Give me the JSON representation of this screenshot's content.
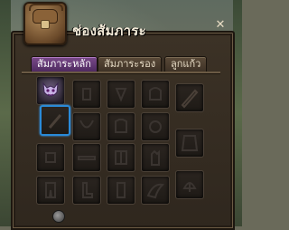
{
  "window": {
    "title": "ช่องสัมภาระ",
    "close_glyph": "✕"
  },
  "tabs": [
    {
      "label": "สัมภาระหลัก",
      "active": true
    },
    {
      "label": "สัมภาระรอง",
      "active": false
    },
    {
      "label": "ลูกแก้ว",
      "active": false
    }
  ],
  "slots": [
    {
      "id": "helmet",
      "icon": "demon-mask-icon",
      "equipped": true
    },
    {
      "id": "slot-2",
      "icon": "slot-2-icon"
    },
    {
      "id": "slot-3",
      "icon": "slot-3-icon"
    },
    {
      "id": "slot-4",
      "icon": "slot-4-icon"
    },
    {
      "id": "weapon-right",
      "icon": "blade-icon"
    },
    {
      "id": "selected-slot",
      "icon": "staff-icon",
      "selected": true
    },
    {
      "id": "neck",
      "icon": "necklace-icon"
    },
    {
      "id": "ring",
      "icon": "ring-icon"
    },
    {
      "id": "slot-9",
      "icon": "slot-9-icon"
    },
    {
      "id": "armor",
      "icon": "armor-icon"
    },
    {
      "id": "belt",
      "icon": "belt-icon"
    },
    {
      "id": "gloves",
      "icon": "gloves-icon"
    },
    {
      "id": "pants",
      "icon": "pants-icon"
    },
    {
      "id": "boots",
      "icon": "boots-icon"
    },
    {
      "id": "cape",
      "icon": "cape-icon"
    },
    {
      "id": "wing",
      "icon": "wing-icon"
    },
    {
      "id": "pet",
      "icon": "pet-icon"
    }
  ]
}
